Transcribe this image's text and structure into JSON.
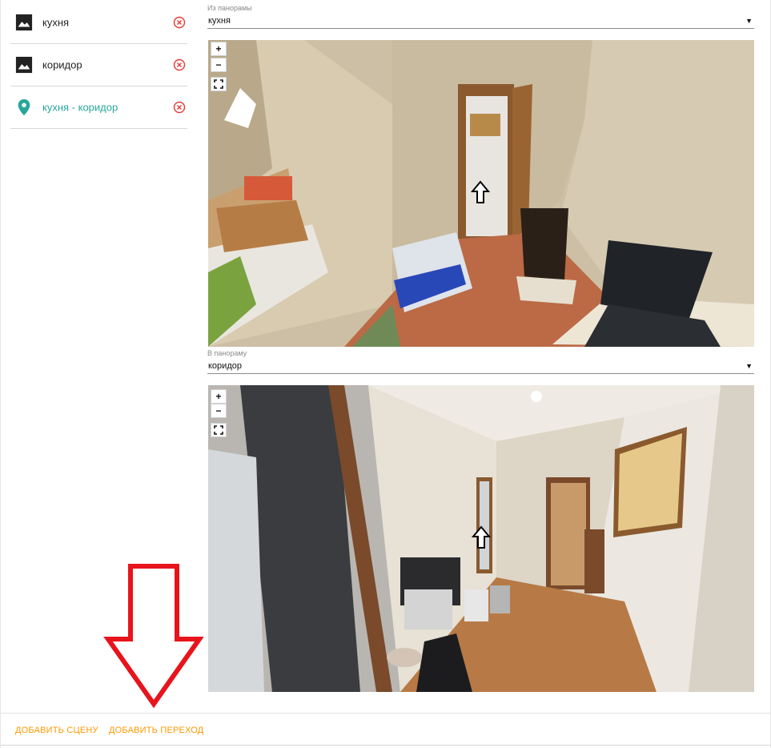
{
  "sidebar": {
    "items": [
      {
        "label": "кухня",
        "icon": "image-icon",
        "type": "scene"
      },
      {
        "label": "коридор",
        "icon": "image-icon",
        "type": "scene"
      },
      {
        "label": "кухня - коридор",
        "icon": "map-pin-icon",
        "type": "transition"
      }
    ]
  },
  "from_panorama": {
    "label": "Из панорамы",
    "value": "кухня"
  },
  "to_panorama": {
    "label": "В панораму",
    "value": "коридор"
  },
  "viewer_controls": {
    "zoom_in": "+",
    "zoom_out": "−"
  },
  "footer": {
    "add_scene_label": "ДОБАВИТЬ СЦЕНУ",
    "add_transition_label": "ДОБАВИТЬ ПЕРЕХОД"
  },
  "colors": {
    "accent": "#26a69a",
    "footer_button": "#ff9800",
    "delete": "#e53935",
    "annotation": "#e8141c"
  }
}
